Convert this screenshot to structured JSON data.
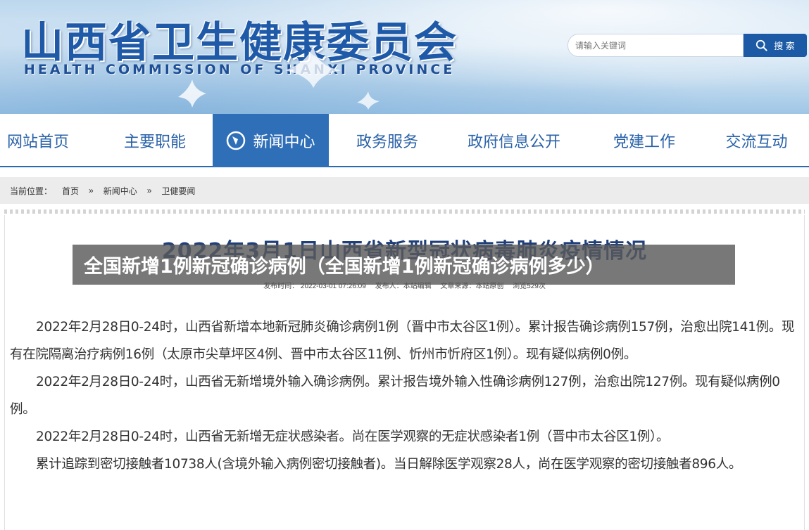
{
  "header": {
    "title": "山西省卫生健康委员会",
    "subtitle": "HEALTH COMMISSION OF SHANXI PROVINCE"
  },
  "search": {
    "placeholder": "请输入关键词",
    "button_label": "搜 索"
  },
  "nav": {
    "items": [
      {
        "label": "网站首页"
      },
      {
        "label": "主要职能"
      },
      {
        "label": "新闻中心",
        "active": true,
        "icon": "globe-icon"
      },
      {
        "label": "政务服务"
      },
      {
        "label": "政府信息公开"
      },
      {
        "label": "党建工作"
      },
      {
        "label": "交流互动"
      }
    ]
  },
  "breadcrumb": {
    "prefix": "当前位置：",
    "items": [
      "首页",
      "»",
      "新闻中心",
      "»",
      "卫健要闻"
    ]
  },
  "article": {
    "title": "2022年3月1日山西省新型冠状病毒肺炎疫情情况",
    "meta": {
      "published": "发布时间： 2022-03-01 07:26:09",
      "author": "发布人：本站编辑",
      "source": "文章来源：本站原创",
      "views": "浏览529次"
    },
    "paragraphs": [
      "2022年2月28日0-24时，山西省新增本地新冠肺炎确诊病例1例（晋中市太谷区1例）。累计报告确诊病例157例，治愈出院141例。现有在院隔离治疗病例16例（太原市尖草坪区4例、晋中市太谷区11例、忻州市忻府区1例）。现有疑似病例0例。",
      "2022年2月28日0-24时，山西省无新增境外输入确诊病例。累计报告境外输入性确诊病例127例，治愈出院127例。现有疑似病例0例。",
      "2022年2月28日0-24时，山西省无新增无症状感染者。尚在医学观察的无症状感染者1例（晋中市太谷区1例）。",
      "累计追踪到密切接触者10738人(含境外输入病例密切接触者)。当日解除医学观察28人，尚在医学观察的密切接触者896人。"
    ]
  },
  "overlay": {
    "text": "全国新增1例新冠确诊病例（全国新增1例新冠确诊病例多少）"
  },
  "colors": {
    "brand_blue": "#2f6fb8",
    "title_blue": "#1f5aa8",
    "overlay_gray": "#5a5a5a"
  }
}
